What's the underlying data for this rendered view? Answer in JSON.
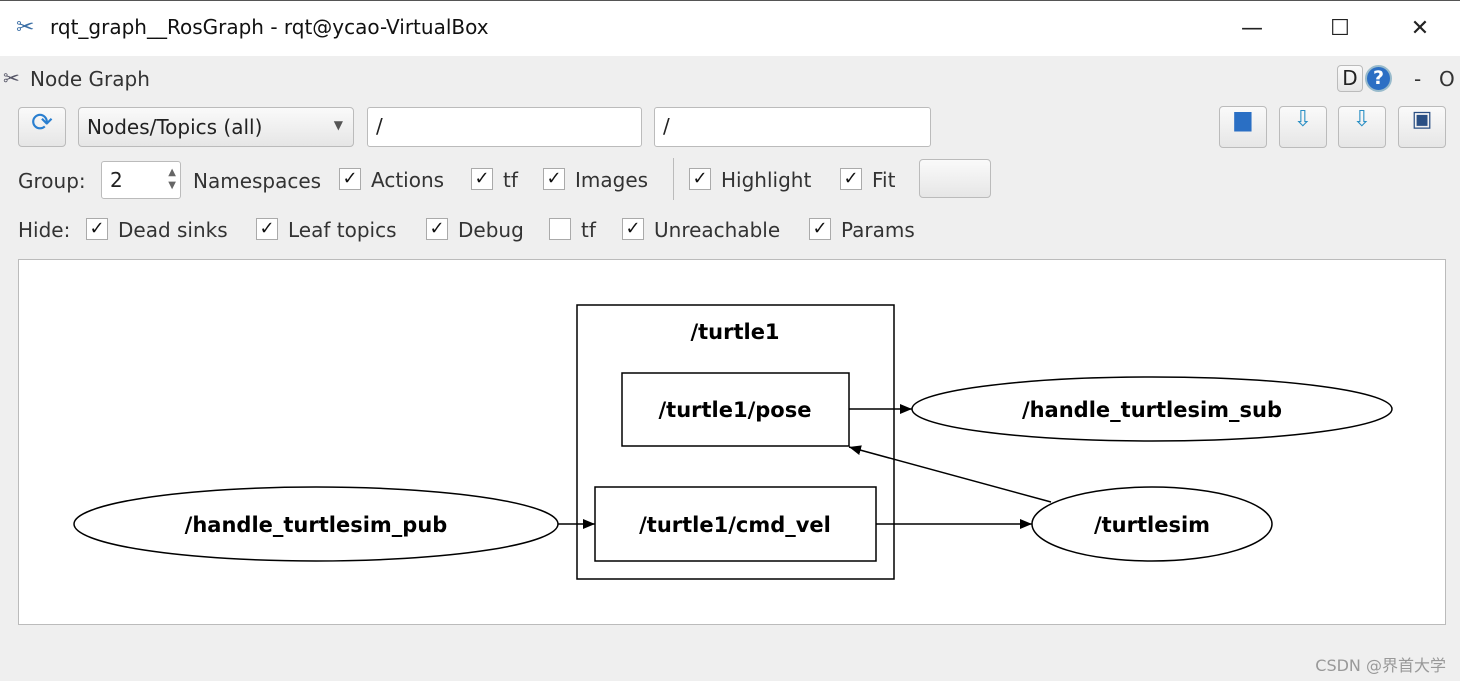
{
  "window": {
    "title": "rqt_graph__RosGraph - rqt@ycao-VirtualBox",
    "min": "—",
    "max": "☐",
    "close": "✕"
  },
  "plugin": {
    "title": "Node Graph",
    "d_label": "D",
    "help": "?",
    "minus": "-",
    "o": "O"
  },
  "toolbar": {
    "mode": "Nodes/Topics (all)",
    "node_filter": "/",
    "topic_filter": "/"
  },
  "options": {
    "group_label": "Group:",
    "group_value": "2",
    "checks": [
      {
        "label": "Namespaces",
        "checked": null
      },
      {
        "label": "Actions",
        "checked": true
      },
      {
        "label": "tf",
        "checked": true
      },
      {
        "label": "Images",
        "checked": true
      },
      {
        "label": "Highlight",
        "checked": true
      },
      {
        "label": "Fit",
        "checked": true
      }
    ]
  },
  "hide": {
    "label": "Hide:",
    "checks": [
      {
        "label": "Dead sinks",
        "checked": true
      },
      {
        "label": "Leaf topics",
        "checked": true
      },
      {
        "label": "Debug",
        "checked": true
      },
      {
        "label": "tf",
        "checked": false
      },
      {
        "label": "Unreachable",
        "checked": true
      },
      {
        "label": "Params",
        "checked": true
      }
    ]
  },
  "graph": {
    "cluster": "/turtle1",
    "topics": [
      "/turtle1/pose",
      "/turtle1/cmd_vel"
    ],
    "nodes": [
      "/handle_turtlesim_sub",
      "/handle_turtlesim_pub",
      "/turtlesim"
    ],
    "edges": [
      [
        "/turtle1/pose",
        "/handle_turtlesim_sub"
      ],
      [
        "/handle_turtlesim_pub",
        "/turtle1/cmd_vel"
      ],
      [
        "/turtle1/cmd_vel",
        "/turtlesim"
      ],
      [
        "/turtlesim",
        "/turtle1/pose"
      ]
    ]
  },
  "watermark": "CSDN @界首大学"
}
